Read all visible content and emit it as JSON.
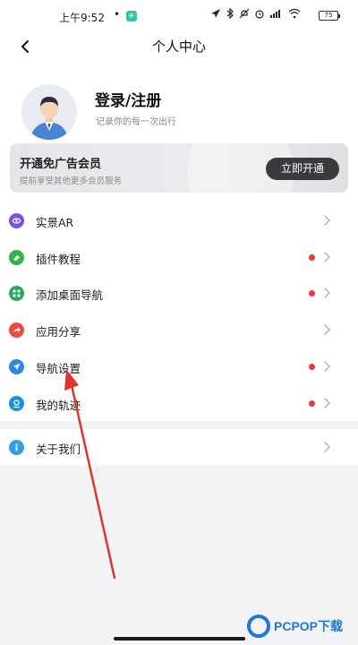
{
  "status_bar": {
    "time": "上午9:52",
    "dot": "•",
    "battery": "75"
  },
  "nav": {
    "title": "个人中心"
  },
  "profile": {
    "title": "登录/注册",
    "subtitle": "记录你的每一次出行"
  },
  "vip": {
    "title": "开通免广告会员",
    "subtitle": "提前享受其他更多会员服务",
    "button": "立即开通"
  },
  "menu": [
    {
      "label": "实景AR",
      "icon": "ar-icon",
      "color": "#7b52e0",
      "dot": false
    },
    {
      "label": "插件教程",
      "icon": "plugin-icon",
      "color": "#34b34a",
      "dot": true
    },
    {
      "label": "添加桌面导航",
      "icon": "grid-icon",
      "color": "#27a95a",
      "dot": true
    },
    {
      "label": "应用分享",
      "icon": "share-icon",
      "color": "#ee4a3a",
      "dot": false
    },
    {
      "label": "导航设置",
      "icon": "navigation-icon",
      "color": "#2a86e8",
      "dot": true
    },
    {
      "label": "我的轨迹",
      "icon": "track-icon",
      "color": "#1c8ee3",
      "dot": true
    }
  ],
  "about": {
    "label": "关于我们",
    "icon": "info-icon",
    "color": "#2fa0e8"
  },
  "watermark": {
    "text": "PCPOP下载"
  },
  "colors": {
    "red_dot": "#e8373e",
    "vip_button": "#3b3b3f",
    "annotation_arrow": "#e0342e"
  }
}
